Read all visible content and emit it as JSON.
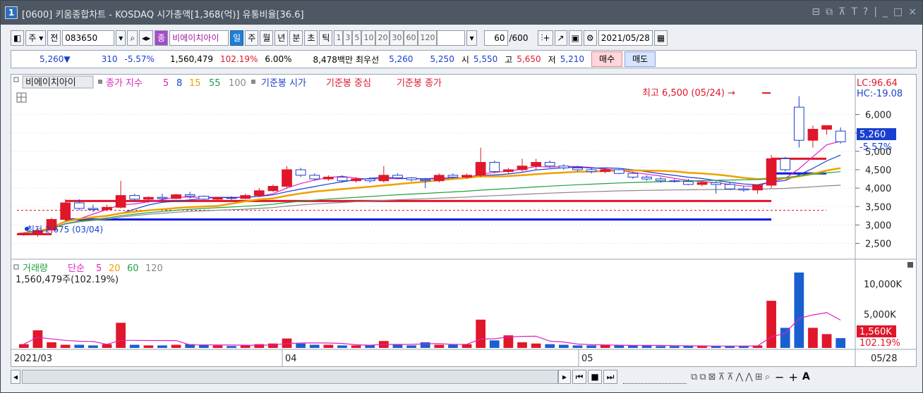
{
  "window": {
    "number": "1",
    "title": "[0600] 키움종합차트 - KOSDAQ 시가총액[1,368(억)] 유통비율[36.6]",
    "controls": [
      "⊟",
      "⧉",
      "⊼",
      "T",
      "?",
      "|",
      "_",
      "□",
      "×"
    ]
  },
  "toolbar": {
    "main_btn": "주",
    "prev_btn": "전",
    "code": "083650",
    "jong": "종",
    "stock_name": "비에이치아이",
    "periods": [
      "일",
      "주",
      "월",
      "년",
      "분",
      "초",
      "틱"
    ],
    "active_period": "일",
    "intervals": [
      "1",
      "3",
      "5",
      "10",
      "20",
      "30",
      "60",
      "120"
    ],
    "count": "60",
    "count_total": "/600",
    "date": "2021/05/28"
  },
  "quote": {
    "price": "5,260",
    "arrow": "▼",
    "change": "310",
    "change_pct": "-5.57%",
    "volume": "1,560,479",
    "volume_ratio": "102.19%",
    "turnover": "6.00%",
    "amount": "8,478백만",
    "best_label": "최우선",
    "ask": "5,260",
    "bid": "5,250",
    "open_label": "시",
    "open": "5,550",
    "high_label": "고",
    "high": "5,650",
    "low_label": "저",
    "low": "5,210",
    "buy_btn": "매수",
    "sell_btn": "매도"
  },
  "legend": {
    "name": "비에이치아이",
    "ma_title": "종가 지수",
    "ma_periods": [
      "5",
      "8",
      "15",
      "55",
      "100"
    ],
    "ma_colors": [
      "#e020c0",
      "#1a3fd0",
      "#f0a000",
      "#20a040",
      "#888888"
    ],
    "base_open": "기준봉 시가",
    "base_mid": "기준봉 중심",
    "base_close": "기준봉 종가",
    "lc": "LC:96.64",
    "hc": "HC:-19.08"
  },
  "annotations": {
    "high": "최고 6,500 (05/24) →",
    "low": "최저 2,675 (03/04)"
  },
  "price_axis": {
    "ticks": [
      "6,000",
      "5,500",
      "5,000",
      "4,500",
      "4,000",
      "3,500",
      "3,000",
      "2,500"
    ],
    "current": "5,260",
    "current_pct": "-5.57%"
  },
  "volume_panel": {
    "title": "거래량",
    "ma_title": "단순",
    "ma_periods": [
      "5",
      "20",
      "60",
      "120"
    ],
    "info": "1,560,479주(102.19%)",
    "ticks": [
      "10,000K",
      "5,000K"
    ],
    "current": "1,560K",
    "current_pct": "102.19%"
  },
  "x_axis": {
    "labels": [
      "2021/03",
      "04",
      "05"
    ],
    "end": "05/28"
  },
  "chart_data": {
    "type": "candlestick",
    "ylim": [
      2300,
      6700
    ],
    "candles": [
      {
        "o": 2750,
        "h": 2800,
        "l": 2700,
        "c": 2780
      },
      {
        "o": 2780,
        "h": 2900,
        "l": 2675,
        "c": 2850
      },
      {
        "o": 2860,
        "h": 3200,
        "l": 2800,
        "c": 3150
      },
      {
        "o": 3150,
        "h": 3700,
        "l": 3100,
        "c": 3600
      },
      {
        "o": 3600,
        "h": 3700,
        "l": 3400,
        "c": 3450
      },
      {
        "o": 3450,
        "h": 3550,
        "l": 3350,
        "c": 3420
      },
      {
        "o": 3420,
        "h": 3550,
        "l": 3380,
        "c": 3480
      },
      {
        "o": 3480,
        "h": 4200,
        "l": 3450,
        "c": 3800
      },
      {
        "o": 3800,
        "h": 3850,
        "l": 3650,
        "c": 3700
      },
      {
        "o": 3700,
        "h": 3780,
        "l": 3600,
        "c": 3750
      },
      {
        "o": 3750,
        "h": 3850,
        "l": 3650,
        "c": 3720
      },
      {
        "o": 3720,
        "h": 3850,
        "l": 3700,
        "c": 3820
      },
      {
        "o": 3820,
        "h": 3900,
        "l": 3720,
        "c": 3780
      },
      {
        "o": 3780,
        "h": 3800,
        "l": 3680,
        "c": 3700
      },
      {
        "o": 3700,
        "h": 3760,
        "l": 3650,
        "c": 3740
      },
      {
        "o": 3740,
        "h": 3780,
        "l": 3680,
        "c": 3720
      },
      {
        "o": 3720,
        "h": 3850,
        "l": 3700,
        "c": 3800
      },
      {
        "o": 3800,
        "h": 4000,
        "l": 3750,
        "c": 3930
      },
      {
        "o": 3930,
        "h": 4100,
        "l": 3900,
        "c": 4050
      },
      {
        "o": 4050,
        "h": 4600,
        "l": 4000,
        "c": 4500
      },
      {
        "o": 4500,
        "h": 4550,
        "l": 4300,
        "c": 4350
      },
      {
        "o": 4350,
        "h": 4400,
        "l": 4200,
        "c": 4250
      },
      {
        "o": 4250,
        "h": 4350,
        "l": 4200,
        "c": 4300
      },
      {
        "o": 4300,
        "h": 4350,
        "l": 4150,
        "c": 4200
      },
      {
        "o": 4200,
        "h": 4300,
        "l": 4150,
        "c": 4250
      },
      {
        "o": 4250,
        "h": 4300,
        "l": 4150,
        "c": 4200
      },
      {
        "o": 4200,
        "h": 4600,
        "l": 4150,
        "c": 4350
      },
      {
        "o": 4350,
        "h": 4400,
        "l": 4250,
        "c": 4280
      },
      {
        "o": 4280,
        "h": 4300,
        "l": 4180,
        "c": 4230
      },
      {
        "o": 4230,
        "h": 4280,
        "l": 4000,
        "c": 4200
      },
      {
        "o": 4200,
        "h": 4400,
        "l": 4150,
        "c": 4350
      },
      {
        "o": 4350,
        "h": 4400,
        "l": 4250,
        "c": 4300
      },
      {
        "o": 4300,
        "h": 4400,
        "l": 4250,
        "c": 4350
      },
      {
        "o": 4350,
        "h": 5100,
        "l": 4300,
        "c": 4700
      },
      {
        "o": 4700,
        "h": 4750,
        "l": 4400,
        "c": 4450
      },
      {
        "o": 4450,
        "h": 4550,
        "l": 4400,
        "c": 4500
      },
      {
        "o": 4500,
        "h": 4800,
        "l": 4450,
        "c": 4600
      },
      {
        "o": 4600,
        "h": 4800,
        "l": 4500,
        "c": 4700
      },
      {
        "o": 4700,
        "h": 4750,
        "l": 4550,
        "c": 4600
      },
      {
        "o": 4600,
        "h": 4650,
        "l": 4500,
        "c": 4550
      },
      {
        "o": 4550,
        "h": 4600,
        "l": 4450,
        "c": 4500
      },
      {
        "o": 4500,
        "h": 4550,
        "l": 4400,
        "c": 4450
      },
      {
        "o": 4450,
        "h": 4550,
        "l": 4400,
        "c": 4500
      },
      {
        "o": 4500,
        "h": 4520,
        "l": 4380,
        "c": 4400
      },
      {
        "o": 4400,
        "h": 4450,
        "l": 4250,
        "c": 4300
      },
      {
        "o": 4300,
        "h": 4350,
        "l": 4200,
        "c": 4250
      },
      {
        "o": 4250,
        "h": 4300,
        "l": 4150,
        "c": 4200
      },
      {
        "o": 4200,
        "h": 4250,
        "l": 4150,
        "c": 4180
      },
      {
        "o": 4180,
        "h": 4250,
        "l": 4080,
        "c": 4100
      },
      {
        "o": 4100,
        "h": 4200,
        "l": 4050,
        "c": 4150
      },
      {
        "o": 4150,
        "h": 4200,
        "l": 3850,
        "c": 4100
      },
      {
        "o": 4100,
        "h": 4150,
        "l": 3950,
        "c": 3980
      },
      {
        "o": 3980,
        "h": 4050,
        "l": 3900,
        "c": 3950
      },
      {
        "o": 3950,
        "h": 4100,
        "l": 3850,
        "c": 4080
      },
      {
        "o": 4080,
        "h": 4900,
        "l": 4000,
        "c": 4800
      },
      {
        "o": 4800,
        "h": 4850,
        "l": 4450,
        "c": 4500
      },
      {
        "o": 6200,
        "h": 6500,
        "l": 5100,
        "c": 5300
      },
      {
        "o": 5300,
        "h": 5700,
        "l": 5100,
        "c": 5600
      },
      {
        "o": 5600,
        "h": 5700,
        "l": 5450,
        "c": 5700
      },
      {
        "o": 5550,
        "h": 5650,
        "l": 5210,
        "c": 5260
      }
    ],
    "volume_k": [
      600,
      2800,
      900,
      500,
      500,
      400,
      600,
      4000,
      500,
      400,
      400,
      500,
      600,
      500,
      400,
      300,
      400,
      600,
      700,
      1500,
      700,
      500,
      500,
      400,
      400,
      400,
      1100,
      500,
      400,
      900,
      500,
      500,
      600,
      4500,
      1200,
      2000,
      900,
      700,
      600,
      500,
      400,
      400,
      500,
      400,
      400,
      400,
      300,
      300,
      300,
      300,
      300,
      300,
      300,
      400,
      7500,
      3200,
      12000,
      3200,
      2200,
      1560
    ],
    "volume_up": [
      true,
      true,
      true,
      true,
      false,
      false,
      true,
      true,
      false,
      true,
      false,
      true,
      false,
      false,
      true,
      false,
      true,
      true,
      true,
      true,
      false,
      false,
      true,
      false,
      true,
      false,
      true,
      false,
      false,
      false,
      true,
      false,
      true,
      true,
      false,
      true,
      true,
      true,
      false,
      false,
      false,
      false,
      true,
      false,
      false,
      false,
      false,
      false,
      false,
      true,
      false,
      false,
      false,
      true,
      true,
      false,
      false,
      true,
      true,
      false
    ],
    "base_open": 3150,
    "base_mid": 3650,
    "base_close": 4200
  }
}
